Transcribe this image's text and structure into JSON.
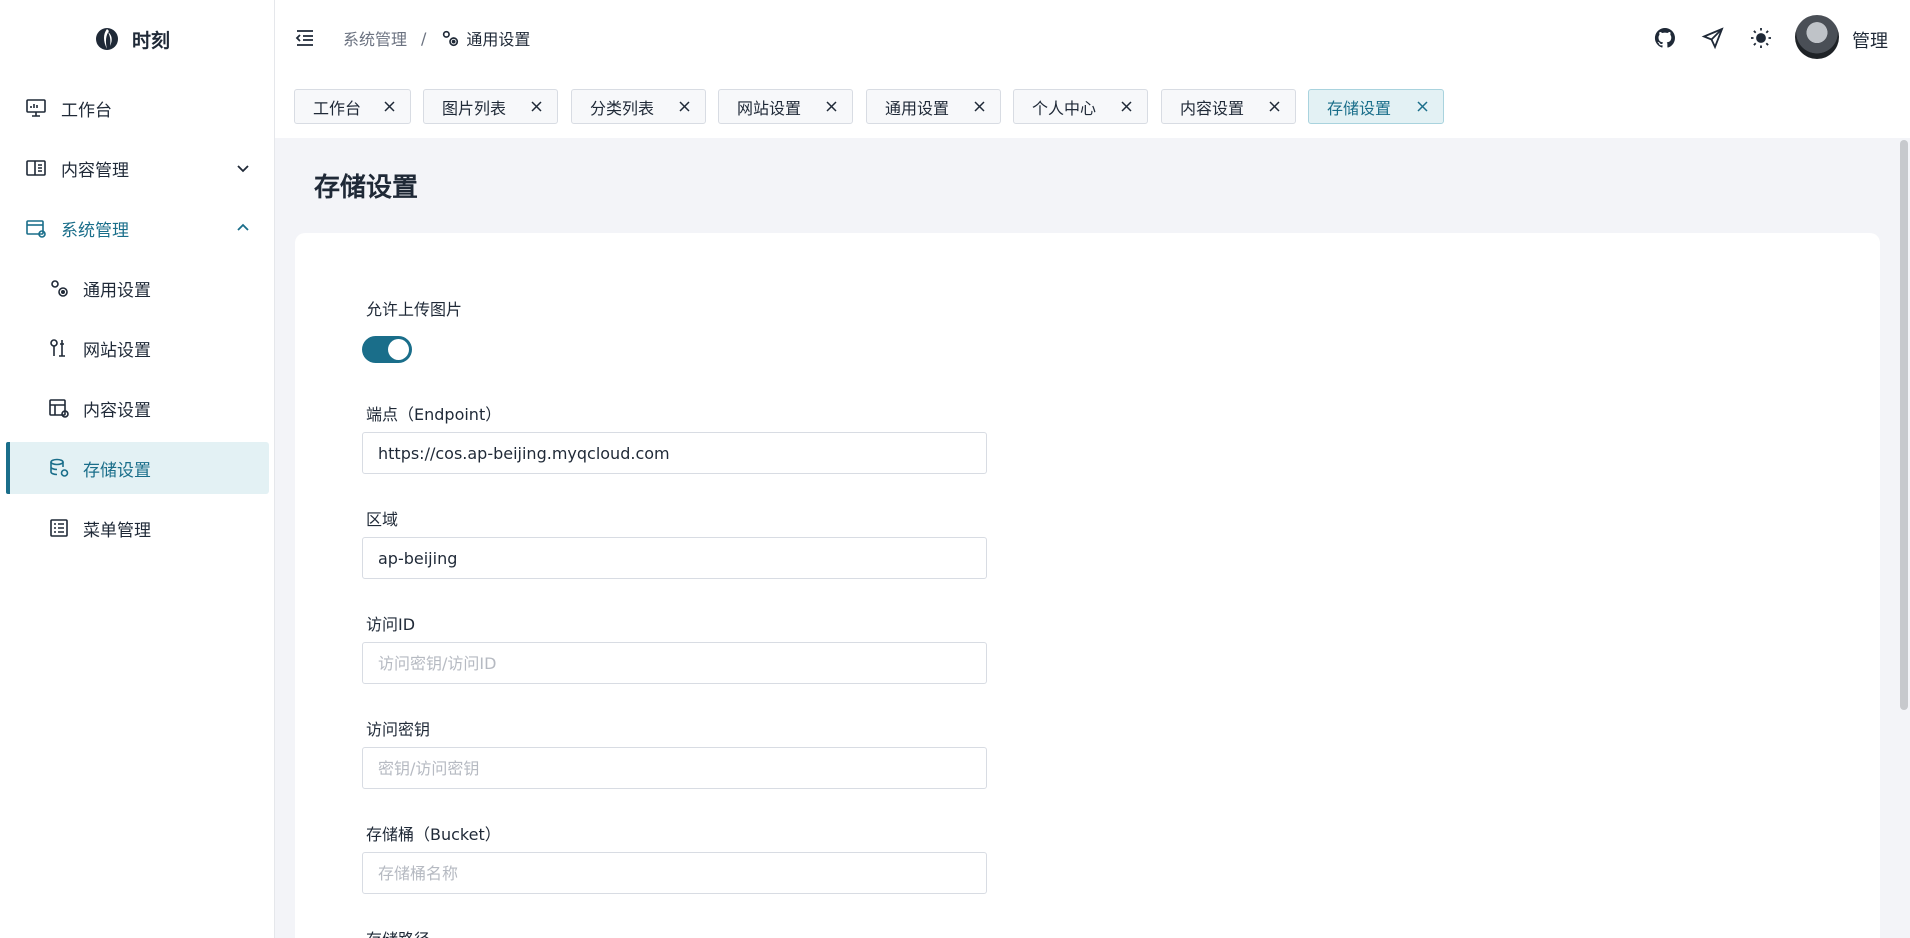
{
  "app": {
    "logo_text": "时刻"
  },
  "sidebar": {
    "items": [
      {
        "label": "工作台",
        "icon": "monitor-icon"
      },
      {
        "label": "内容管理",
        "icon": "content-panel-icon"
      },
      {
        "label": "系统管理",
        "icon": "system-settings-icon"
      },
      {
        "label": "通用设置",
        "icon": "gears-icon"
      },
      {
        "label": "网站设置",
        "icon": "tools-icon"
      },
      {
        "label": "内容设置",
        "icon": "content-settings-icon"
      },
      {
        "label": "存储设置",
        "icon": "database-settings-icon",
        "active": true
      },
      {
        "label": "菜单管理",
        "icon": "list-icon"
      }
    ]
  },
  "header": {
    "breadcrumb": {
      "parent": "系统管理",
      "separator": "/",
      "current": "通用设置"
    },
    "user_name": "管理"
  },
  "tabs": [
    {
      "label": "工作台"
    },
    {
      "label": "图片列表"
    },
    {
      "label": "分类列表"
    },
    {
      "label": "网站设置"
    },
    {
      "label": "通用设置"
    },
    {
      "label": "个人中心"
    },
    {
      "label": "内容设置"
    },
    {
      "label": "存储设置",
      "active": true
    }
  ],
  "main": {
    "page_title": "存储设置",
    "allow_upload": {
      "label": "允许上传图片",
      "enabled": true
    },
    "fields": {
      "endpoint": {
        "label": "端点（Endpoint）",
        "value": "https://cos.ap-beijing.myqcloud.com",
        "placeholder": ""
      },
      "region": {
        "label": "区域",
        "value": "ap-beijing",
        "placeholder": ""
      },
      "access_id": {
        "label": "访问ID",
        "value": "",
        "placeholder": "访问密钥/访问ID"
      },
      "access_key": {
        "label": "访问密钥",
        "value": "",
        "placeholder": "密钥/访问密钥"
      },
      "bucket": {
        "label": "存储桶（Bucket）",
        "value": "",
        "placeholder": "存储桶名称"
      },
      "path": {
        "label": "存储路径"
      }
    }
  },
  "colors": {
    "accent": "#1a6e8a",
    "active_bg": "#e3f1f4",
    "page_bg": "#f3f4f8"
  }
}
